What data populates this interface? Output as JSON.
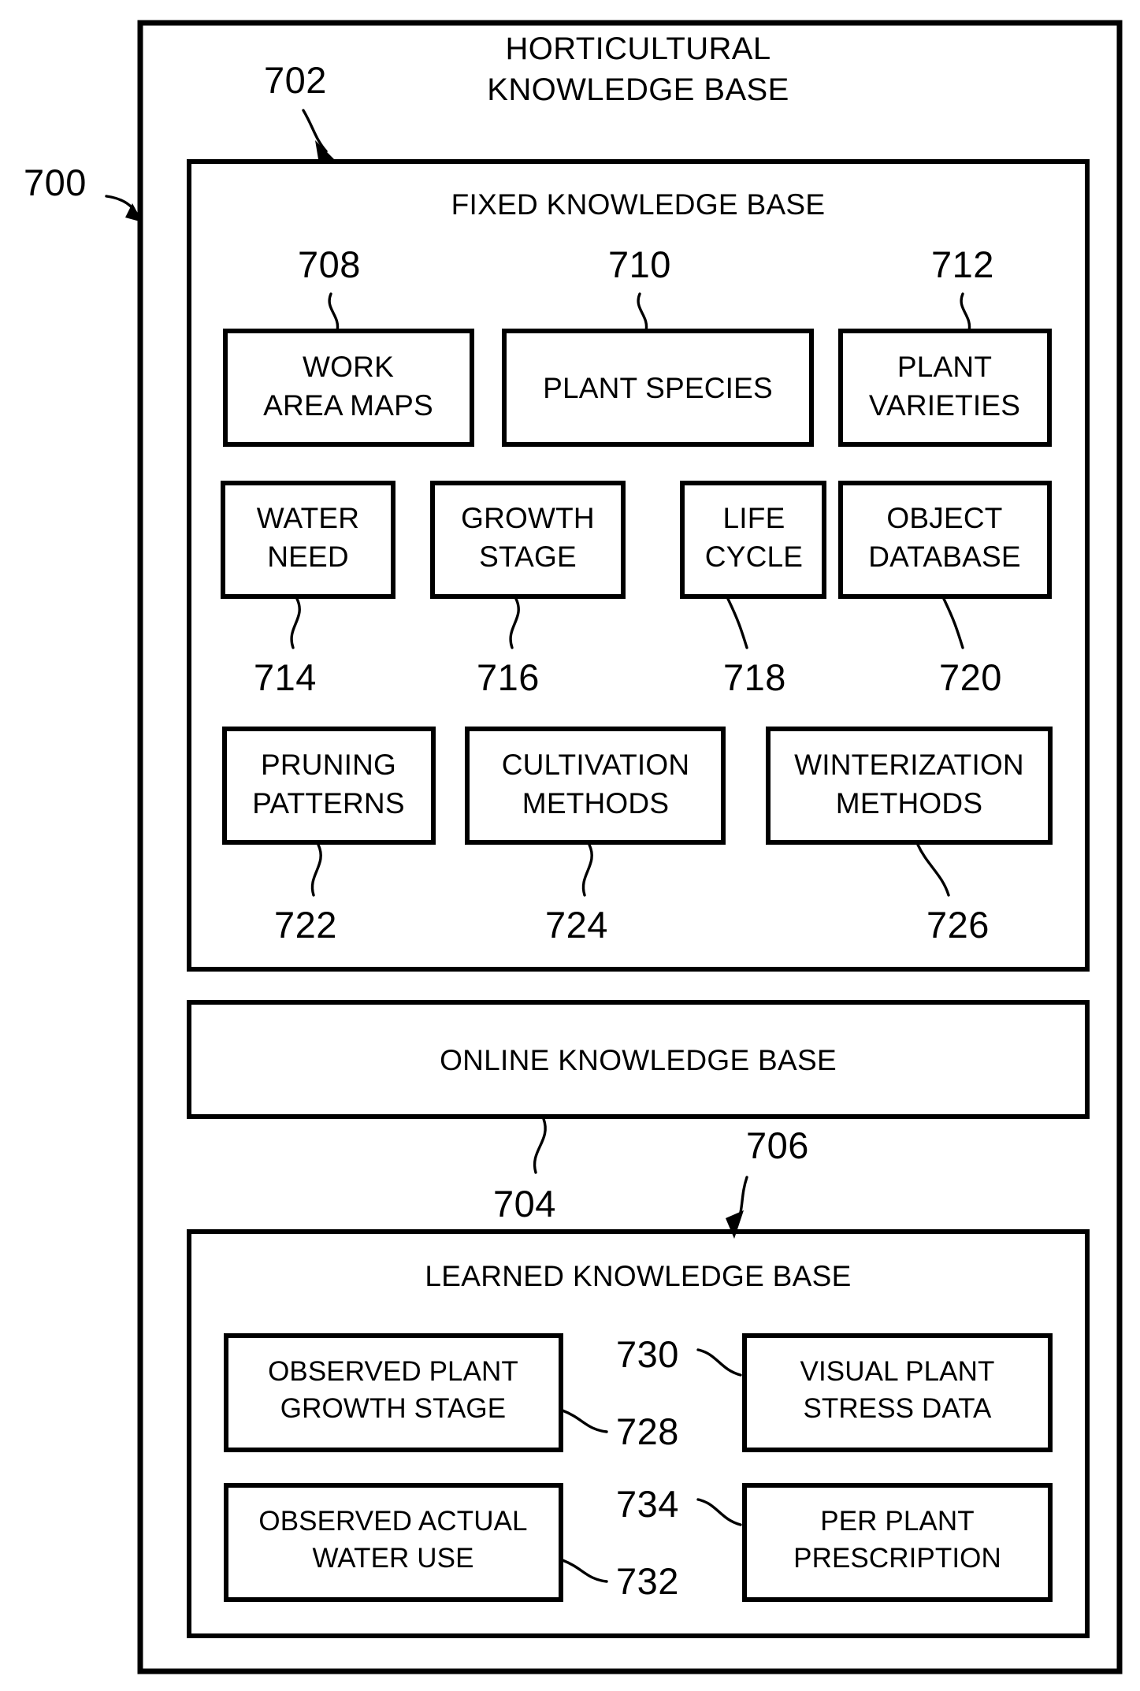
{
  "figure": {
    "outer_ref": "700",
    "title_line1": "HORTICULTURAL",
    "title_line2": "KNOWLEDGE BASE",
    "title_ref": "702"
  },
  "sections": {
    "fixed": {
      "label": "FIXED KNOWLEDGE BASE",
      "ref": "702"
    },
    "online": {
      "label": "ONLINE KNOWLEDGE BASE",
      "ref": "704"
    },
    "learned": {
      "label": "LEARNED KNOWLEDGE BASE",
      "ref": "706"
    }
  },
  "fixed_nodes": [
    {
      "ref": "708",
      "line1": "WORK",
      "line2": "AREA MAPS"
    },
    {
      "ref": "710",
      "line1": "PLANT SPECIES",
      "line2": ""
    },
    {
      "ref": "712",
      "line1": "PLANT",
      "line2": "VARIETIES"
    },
    {
      "ref": "714",
      "line1": "WATER",
      "line2": "NEED"
    },
    {
      "ref": "716",
      "line1": "GROWTH",
      "line2": "STAGE"
    },
    {
      "ref": "718",
      "line1": "LIFE",
      "line2": "CYCLE"
    },
    {
      "ref": "720",
      "line1": "OBJECT",
      "line2": "DATABASE"
    },
    {
      "ref": "722",
      "line1": "PRUNING",
      "line2": "PATTERNS"
    },
    {
      "ref": "724",
      "line1": "CULTIVATION",
      "line2": "METHODS"
    },
    {
      "ref": "726",
      "line1": "WINTERIZATION",
      "line2": "METHODS"
    }
  ],
  "learned_nodes": [
    {
      "ref": "728",
      "line1": "OBSERVED PLANT",
      "line2": "GROWTH STAGE"
    },
    {
      "ref": "730",
      "line1": "VISUAL PLANT",
      "line2": "STRESS DATA"
    },
    {
      "ref": "732",
      "line1": "OBSERVED ACTUAL",
      "line2": "WATER USE"
    },
    {
      "ref": "734",
      "line1": "PER PLANT",
      "line2": "PRESCRIPTION"
    }
  ],
  "colors": {
    "ink": "#000000",
    "paper": "#ffffff"
  }
}
